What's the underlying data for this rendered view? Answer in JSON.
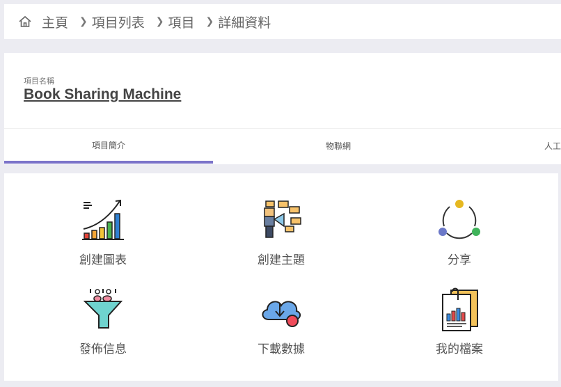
{
  "breadcrumb": {
    "items": [
      "主頁",
      "項目列表",
      "項目",
      "詳細資料"
    ]
  },
  "project": {
    "label": "項目名稱",
    "name": "Book Sharing Machine"
  },
  "tabs": [
    {
      "label": "項目簡介"
    },
    {
      "label": "物聯網"
    },
    {
      "label": "人工"
    }
  ],
  "actions": [
    {
      "label": "創建圖表",
      "icon": "chart-growth-icon"
    },
    {
      "label": "創建主題",
      "icon": "announcement-icon"
    },
    {
      "label": "分享",
      "icon": "share-cycle-icon"
    },
    {
      "label": "發佈信息",
      "icon": "funnel-icon"
    },
    {
      "label": "下載數據",
      "icon": "cloud-download-icon"
    },
    {
      "label": "我的檔案",
      "icon": "file-report-icon"
    }
  ]
}
